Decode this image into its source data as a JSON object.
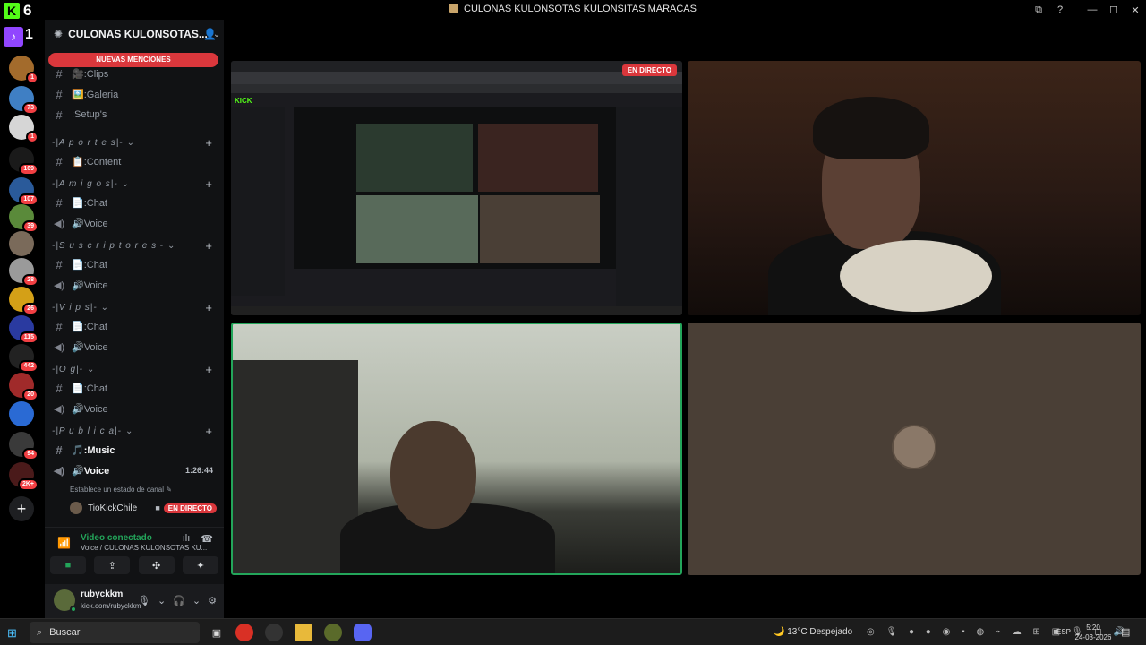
{
  "window": {
    "app_logo_letter": "K",
    "app_number": "6",
    "title": "CULONAS KULONSOTAS KULONSITAS MARACAS",
    "controls": {
      "inbox": "⧉",
      "help": "?",
      "minimize": "—",
      "maximize": "☐",
      "close": "✕"
    }
  },
  "rail": {
    "twitch_letter": "♪",
    "twitch_number": "1",
    "servers": [
      {
        "badge": "1",
        "color": "#a36b2c"
      },
      {
        "badge": "73",
        "color": "#3f7fc4"
      },
      {
        "badge": "1",
        "color": "#d6d6d6"
      },
      {
        "badge": "169",
        "color": "#1a1a1a"
      },
      {
        "badge": "107",
        "color": "#2a5a9a"
      },
      {
        "badge": "39",
        "color": "#5a8a3a"
      },
      {
        "badge": "",
        "color": "#7a6a5a"
      },
      {
        "badge": "28",
        "color": "#9a9a9a"
      },
      {
        "badge": "26",
        "color": "#d4a017"
      },
      {
        "badge": "115",
        "color": "#2a3aa0"
      },
      {
        "badge": "442",
        "color": "#222"
      },
      {
        "badge": "20",
        "color": "#a02a2a"
      },
      {
        "badge": "",
        "color": "#2a6ad4"
      },
      {
        "badge": "94",
        "color": "#3a3a3a"
      },
      {
        "badge": "2K+",
        "color": "#4a1a1a"
      }
    ],
    "add_server": "+"
  },
  "sidebar": {
    "server_name": "CULONAS KULONSOTAS...",
    "mentions_banner": "NUEVAS MENCIONES",
    "channels_top": [
      {
        "label": "🎥:Clips"
      },
      {
        "label": "🖼️:Galeria"
      },
      {
        "label": ":Setup's"
      }
    ],
    "categories": [
      {
        "name": "-|A p o r t e s|-",
        "channels": [
          {
            "type": "text",
            "label": "📋:Content"
          }
        ]
      },
      {
        "name": "-|A m i g o s|-",
        "channels": [
          {
            "type": "text",
            "label": "📄:Chat"
          },
          {
            "type": "voice",
            "label": "🔊Voice"
          }
        ]
      },
      {
        "name": "-|S u s c r i p t o r e s|-",
        "channels": [
          {
            "type": "text",
            "label": "📄:Chat"
          },
          {
            "type": "voice",
            "label": "🔊Voice"
          }
        ]
      },
      {
        "name": "-|V i p s|-",
        "channels": [
          {
            "type": "text",
            "label": "📄:Chat"
          },
          {
            "type": "voice",
            "label": "🔊Voice"
          }
        ]
      },
      {
        "name": "-|O g|-",
        "channels": [
          {
            "type": "text",
            "label": "📄:Chat"
          },
          {
            "type": "voice",
            "label": "🔊Voice"
          }
        ]
      },
      {
        "name": "-|P u b l i c a|-",
        "channels": [
          {
            "type": "text",
            "label": "🎵:Music"
          },
          {
            "type": "voice",
            "label": "🔊Voice",
            "time": "1:26:44"
          }
        ]
      }
    ],
    "channel_status": "Establece un estado de canal ✎",
    "voice_user": {
      "name": "TioKickChile",
      "live": "EN DIRECTO"
    }
  },
  "voice_panel": {
    "title": "Video conectado",
    "subtitle": "Voice / CULONAS KULONSOTAS KU..."
  },
  "user_panel": {
    "username": "rubyckkm",
    "status": "kick.com/rubyckkm"
  },
  "stage": {
    "live_label": "EN DIRECTO",
    "screen_site": "KICK"
  },
  "taskbar": {
    "search_placeholder": "Buscar",
    "weather": "🌙 13°C  Despejado",
    "language": "ESP",
    "time": "5:20",
    "date": "24-03-2026"
  }
}
